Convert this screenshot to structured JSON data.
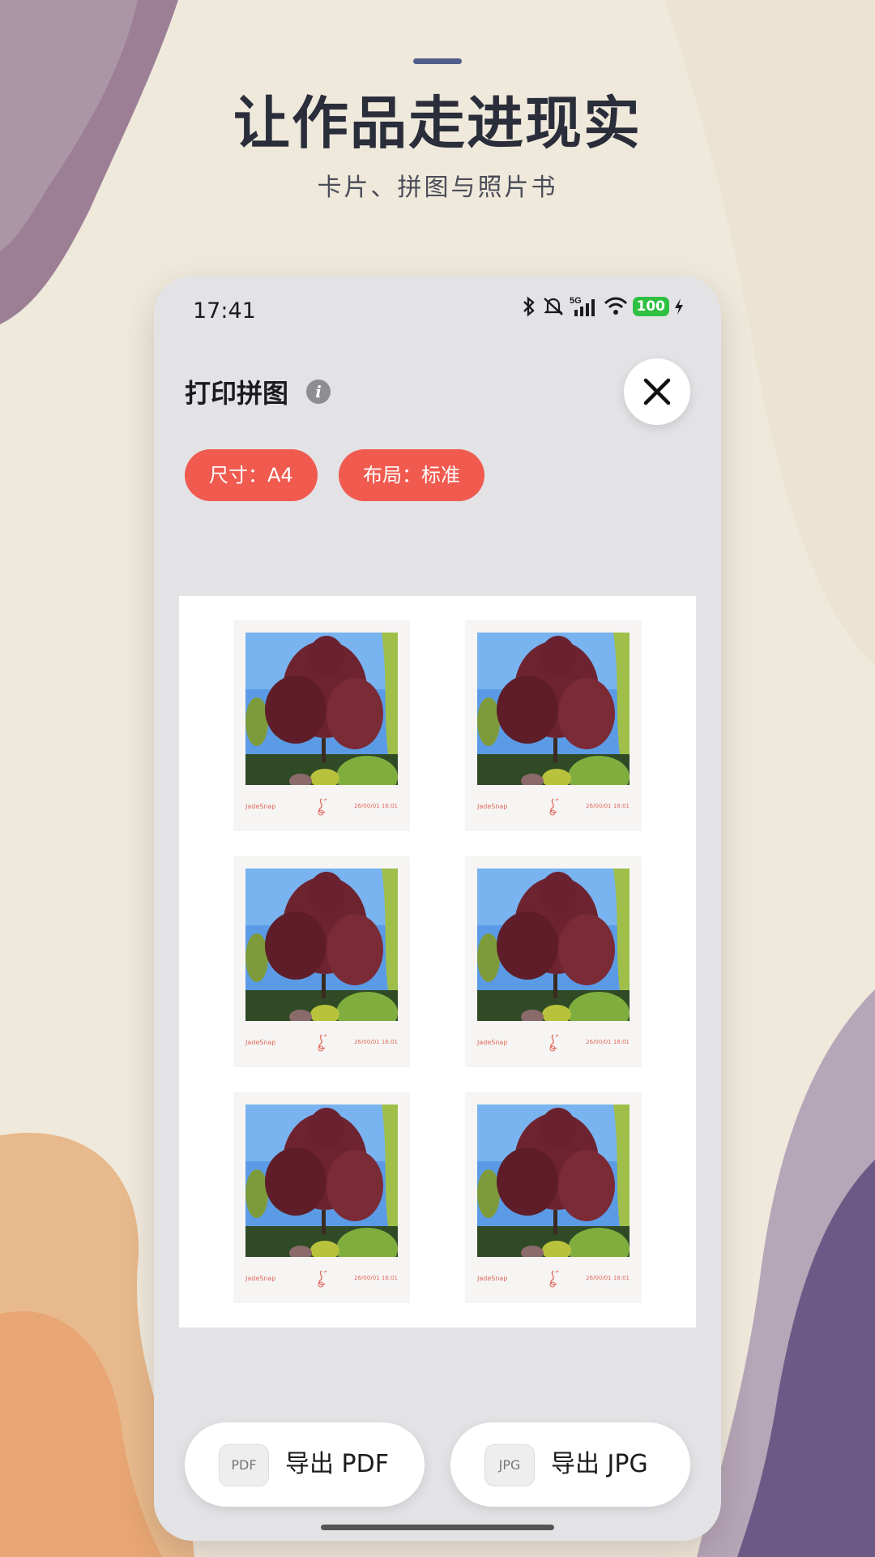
{
  "hero": {
    "title": "让作品走进现实",
    "subtitle": "卡片、拼图与照片书"
  },
  "status_bar": {
    "time": "17:41",
    "network": "5G",
    "battery": "100"
  },
  "screen": {
    "title": "打印拼图",
    "filters": {
      "size": "尺寸：A4",
      "layout": "布局：标准"
    }
  },
  "cards": [
    {
      "brand": "JadeSnap",
      "timestamp": "26/00/01 16:01"
    },
    {
      "brand": "JadeSnap",
      "timestamp": "26/00/01 16:01"
    },
    {
      "brand": "JadeSnap",
      "timestamp": "26/00/01 16:01"
    },
    {
      "brand": "JadeSnap",
      "timestamp": "26/00/01 16:01"
    },
    {
      "brand": "JadeSnap",
      "timestamp": "26/00/01 16:01"
    },
    {
      "brand": "JadeSnap",
      "timestamp": "26/00/01 16:01"
    }
  ],
  "export": {
    "pdf": {
      "badge": "PDF",
      "label": "导出 PDF"
    },
    "jpg": {
      "badge": "JPG",
      "label": "导出 JPG"
    }
  },
  "colors": {
    "accent": "#f05a4f",
    "title": "#2a2d3a",
    "battery": "#2fc042"
  }
}
